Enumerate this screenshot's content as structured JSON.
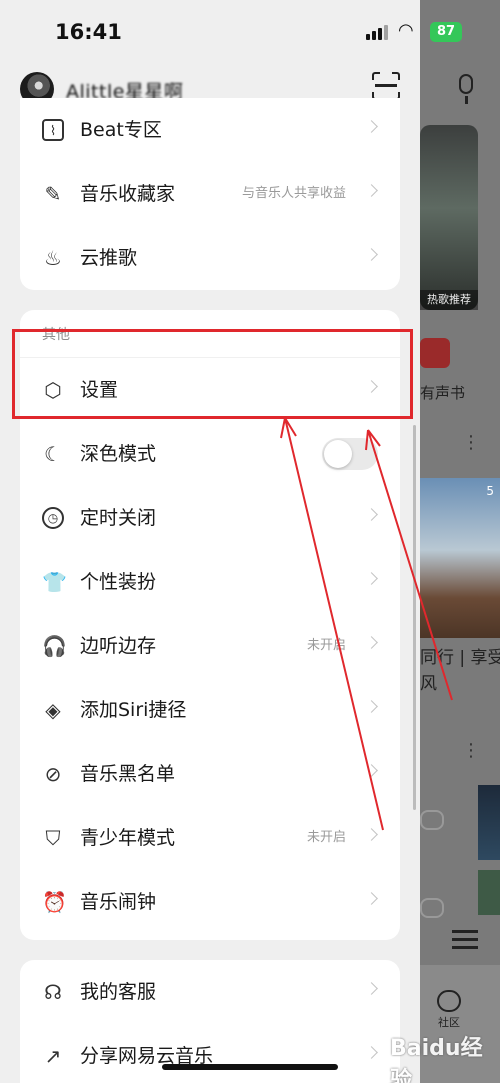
{
  "status_bar": {
    "time": "16:41",
    "battery": "87"
  },
  "header": {
    "username": "Alittle星星啊"
  },
  "menu_top": {
    "items": [
      {
        "label": "Beat专区",
        "sub": ""
      },
      {
        "label": "音乐收藏家",
        "sub": "与音乐人共享收益"
      },
      {
        "label": "云推歌",
        "sub": ""
      }
    ]
  },
  "menu_other": {
    "section_title": "其他",
    "items": [
      {
        "label": "设置",
        "sub": ""
      },
      {
        "label": "深色模式",
        "sub": ""
      },
      {
        "label": "定时关闭",
        "sub": ""
      },
      {
        "label": "个性装扮",
        "sub": ""
      },
      {
        "label": "边听边存",
        "sub": "未开启"
      },
      {
        "label": "添加Siri捷径",
        "sub": ""
      },
      {
        "label": "音乐黑名单",
        "sub": ""
      },
      {
        "label": "青少年模式",
        "sub": "未开启"
      },
      {
        "label": "音乐闹钟",
        "sub": ""
      }
    ],
    "dark_mode_enabled": false
  },
  "menu_bottom": {
    "items": [
      {
        "label": "我的客服",
        "sub": ""
      },
      {
        "label": "分享网易云音乐",
        "sub": ""
      }
    ]
  },
  "background_app": {
    "playlist_caption": "热歌推荐",
    "audio_book_label": "有声书",
    "feed_text": "同行 | 享受风",
    "community_label": "社区",
    "photo_count": "5"
  },
  "watermark": "Baidu经验",
  "colors": {
    "highlight": "#e0282d",
    "toggle_off": "#e9e9e9",
    "battery": "#34c759"
  }
}
